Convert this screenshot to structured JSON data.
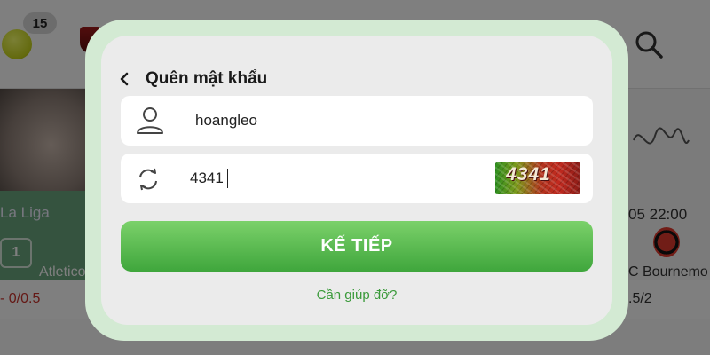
{
  "background": {
    "notification_count": "15",
    "match_left": {
      "league": "La Liga",
      "score": "1",
      "team": "Atletico",
      "odds": "- 0/0.5"
    },
    "match_right": {
      "datetime": "05 22:00",
      "team": "C Bournemo",
      "odds": ".5/2"
    },
    "icons": [
      "tennis-ball-icon",
      "club-logo-icon",
      "search-icon",
      "bournemouth-logo-icon"
    ]
  },
  "modal": {
    "title": "Quên mật khẩu",
    "back_icon": "chevron-left-icon",
    "username": {
      "value": "hoangleo",
      "icon": "user-icon"
    },
    "captcha": {
      "value": "4341",
      "image_text": "4341",
      "icon": "refresh-icon"
    },
    "next_button_label": "KẾ TIẾP",
    "help_link": "Cần giúp đỡ?"
  },
  "colors": {
    "accent_green": "#4caf50",
    "link_green": "#3a9a3a",
    "modal_frame": "#d3ead3",
    "modal_bg": "#ebebeb"
  }
}
